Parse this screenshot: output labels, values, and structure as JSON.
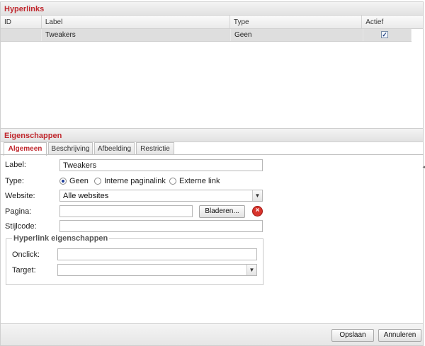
{
  "hyperlinks": {
    "title": "Hyperlinks",
    "columns": [
      "ID",
      "Label",
      "Type",
      "Actief"
    ],
    "rows": [
      {
        "id": "",
        "label": "Tweakers",
        "type": "Geen",
        "actief": true
      }
    ]
  },
  "properties": {
    "title": "Eigenschappen",
    "tabs": [
      "Algemeen",
      "Beschrijving",
      "Afbeelding",
      "Restrictie"
    ],
    "active_tab": "Algemeen",
    "form": {
      "label_label": "Label:",
      "label_value": "Tweakers",
      "type_label": "Type:",
      "type_options": [
        "Geen",
        "Interne paginalink",
        "Externe link"
      ],
      "type_selected": "Geen",
      "website_label": "Website:",
      "website_value": "Alle websites",
      "pagina_label": "Pagina:",
      "pagina_value": "",
      "browse_button": "Bladeren...",
      "stijlcode_label": "Stijlcode:",
      "stijlcode_value": "",
      "group_title": "Hyperlink eigenschappen",
      "onclick_label": "Onclick:",
      "onclick_value": "",
      "target_label": "Target:",
      "target_value": ""
    }
  },
  "footer": {
    "save_button": "Opslaan",
    "cancel_button": "Annuleren"
  },
  "colors": {
    "header_text": "#c0272d",
    "selected_row": "#dedede"
  }
}
